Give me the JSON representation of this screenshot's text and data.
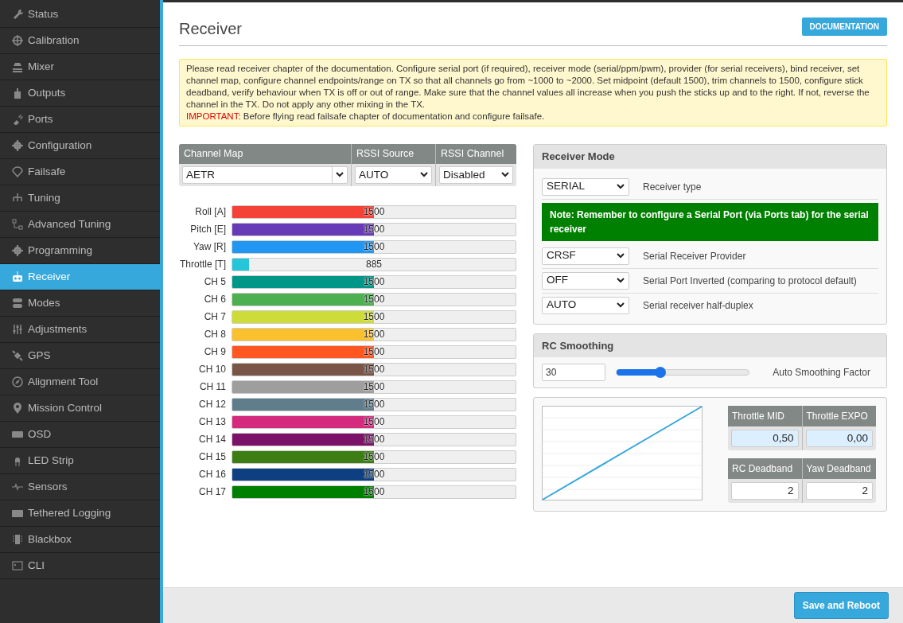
{
  "sidebar": {
    "items": [
      {
        "label": "Status",
        "selected": false
      },
      {
        "label": "Calibration",
        "selected": false
      },
      {
        "label": "Mixer",
        "selected": false
      },
      {
        "label": "Outputs",
        "selected": false
      },
      {
        "label": "Ports",
        "selected": false
      },
      {
        "label": "Configuration",
        "selected": false
      },
      {
        "label": "Failsafe",
        "selected": false
      },
      {
        "label": "Tuning",
        "selected": false
      },
      {
        "label": "Advanced Tuning",
        "selected": false
      },
      {
        "label": "Programming",
        "selected": false
      },
      {
        "label": "Receiver",
        "selected": true
      },
      {
        "label": "Modes",
        "selected": false
      },
      {
        "label": "Adjustments",
        "selected": false
      },
      {
        "label": "GPS",
        "selected": false
      },
      {
        "label": "Alignment Tool",
        "selected": false
      },
      {
        "label": "Mission Control",
        "selected": false
      },
      {
        "label": "OSD",
        "selected": false
      },
      {
        "label": "LED Strip",
        "selected": false
      },
      {
        "label": "Sensors",
        "selected": false
      },
      {
        "label": "Tethered Logging",
        "selected": false
      },
      {
        "label": "Blackbox",
        "selected": false
      },
      {
        "label": "CLI",
        "selected": false
      }
    ]
  },
  "header": {
    "title": "Receiver",
    "documentation_button": "DOCUMENTATION"
  },
  "notice": {
    "text": "Please read receiver chapter of the documentation. Configure serial port (if required), receiver mode (serial/ppm/pwm), provider (for serial receivers), bind receiver, set channel map, configure channel endpoints/range on TX so that all channels go from ~1000 to ~2000. Set midpoint (default 1500), trim channels to 1500, configure stick deadband, verify behaviour when TX is off or out of range. Make sure that the channel values all increase when you push the sticks up and to the right. If not, reverse the channel in the TX. Do not apply any other mixing in the TX.",
    "important_label": "IMPORTANT",
    "important_text": ": Before flying read failsafe chapter of documentation and configure failsafe."
  },
  "channel_settings": {
    "columns": [
      "Channel Map",
      "RSSI Source",
      "RSSI Channel"
    ],
    "values": [
      "AETR",
      "AUTO",
      "Disabled"
    ]
  },
  "channels": [
    {
      "name": "Roll [A]",
      "value": "1500",
      "level": 0.5,
      "color": "#f44336"
    },
    {
      "name": "Pitch [E]",
      "value": "1500",
      "level": 0.5,
      "color": "#673ab7"
    },
    {
      "name": "Yaw [R]",
      "value": "1500",
      "level": 0.5,
      "color": "#2196f3"
    },
    {
      "name": "Throttle [T]",
      "value": "885",
      "level": 0.06,
      "color": "#26c6da"
    },
    {
      "name": "CH 5",
      "value": "1500",
      "level": 0.5,
      "color": "#009688"
    },
    {
      "name": "CH 6",
      "value": "1500",
      "level": 0.5,
      "color": "#4caf50"
    },
    {
      "name": "CH 7",
      "value": "1500",
      "level": 0.5,
      "color": "#cddc39"
    },
    {
      "name": "CH 8",
      "value": "1500",
      "level": 0.5,
      "color": "#fbc02d"
    },
    {
      "name": "CH 9",
      "value": "1500",
      "level": 0.5,
      "color": "#ff5722"
    },
    {
      "name": "CH 10",
      "value": "1500",
      "level": 0.5,
      "color": "#795548"
    },
    {
      "name": "CH 11",
      "value": "1500",
      "level": 0.5,
      "color": "#9e9e9e"
    },
    {
      "name": "CH 12",
      "value": "1500",
      "level": 0.5,
      "color": "#607d8b"
    },
    {
      "name": "CH 13",
      "value": "1500",
      "level": 0.5,
      "color": "#d42b7f"
    },
    {
      "name": "CH 14",
      "value": "1500",
      "level": 0.5,
      "color": "#7b1168"
    },
    {
      "name": "CH 15",
      "value": "1500",
      "level": 0.5,
      "color": "#3c7d14"
    },
    {
      "name": "CH 16",
      "value": "1500",
      "level": 0.5,
      "color": "#0e3f80"
    },
    {
      "name": "CH 17",
      "value": "1500",
      "level": 0.5,
      "color": "#008000"
    }
  ],
  "receiver_mode": {
    "title": "Receiver Mode",
    "rows": [
      {
        "kind": "select",
        "value": "SERIAL",
        "label": "Receiver type"
      },
      {
        "kind": "note",
        "text": "Note: Remember to configure a Serial Port (via Ports tab) for the serial receiver"
      },
      {
        "kind": "select",
        "value": "CRSF",
        "label": "Serial Receiver Provider"
      },
      {
        "kind": "select",
        "value": "OFF",
        "label": "Serial Port Inverted (comparing to protocol default)"
      },
      {
        "kind": "select",
        "value": "AUTO",
        "label": "Serial receiver half-duplex"
      }
    ]
  },
  "rc_smoothing": {
    "title": "RC Smoothing",
    "value": "30",
    "level": 0.33,
    "label": "Auto Smoothing Factor"
  },
  "curve": {
    "tables": [
      {
        "columns": [
          "Throttle MID",
          "Throttle EXPO"
        ],
        "values": [
          "0,50",
          "0,00"
        ],
        "highlighted": true
      },
      {
        "columns": [
          "RC Deadband",
          "Yaw Deadband"
        ],
        "values": [
          "2",
          "2"
        ],
        "highlighted": false
      }
    ]
  },
  "footer": {
    "save_button": "Save and Reboot"
  }
}
